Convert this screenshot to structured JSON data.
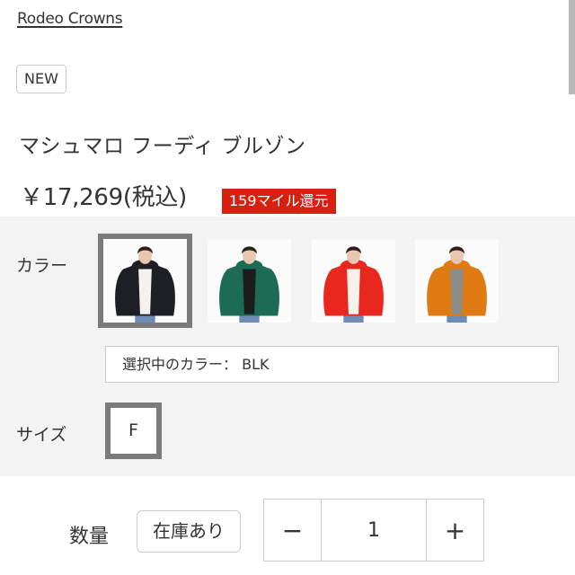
{
  "brand": {
    "name": "Rodeo Crowns"
  },
  "badge": {
    "new_label": "NEW"
  },
  "product": {
    "title": "マシュマロ フーディ ブルゾン",
    "price": "￥17,269(税込)",
    "mile_badge": "159マイル還元"
  },
  "colors": {
    "label": "カラー",
    "selected_text": "選択中のカラー： BLK",
    "options": [
      {
        "code": "BLK",
        "jacket_color": "#1e1f24",
        "inner_color": "#f4f2ee",
        "selected": true
      },
      {
        "code": "GRN",
        "jacket_color": "#1b6b55",
        "inner_color": "#1c1c1c",
        "selected": false
      },
      {
        "code": "RED",
        "jacket_color": "#e8281e",
        "inner_color": "#f6f1ea",
        "selected": false
      },
      {
        "code": "ORG",
        "jacket_color": "#e07a13",
        "inner_color": "#8c8c88",
        "selected": false
      }
    ]
  },
  "size": {
    "label": "サイズ",
    "selected": "F"
  },
  "quantity": {
    "label": "数量",
    "stock_status": "在庫あり",
    "value": "1",
    "minus_symbol": "−",
    "plus_symbol": "+"
  },
  "theme": {
    "accent_red": "#d7200f",
    "panel_bg": "#f3f3f3",
    "selected_border": "#7b7b7b"
  }
}
